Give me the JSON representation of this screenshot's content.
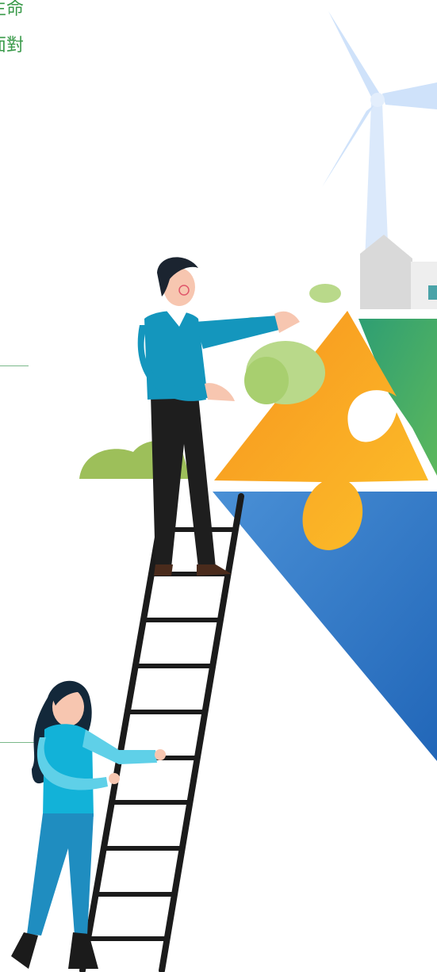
{
  "text": {
    "line1": "生命",
    "line2": "面對"
  },
  "colors": {
    "text_green": "#3a9a4a",
    "turbine": "#d6e6fb",
    "puzzle_orange": "#f7931e",
    "puzzle_yellow": "#ffd12e",
    "puzzle_green": "#2e9e73",
    "puzzle_blue": "#3b7fce",
    "shirt_teal": "#1a9dc4",
    "ladder": "#1b1b1b"
  },
  "icons": [
    "wind-turbine",
    "house",
    "puzzle-piece",
    "ladder",
    "bush"
  ]
}
